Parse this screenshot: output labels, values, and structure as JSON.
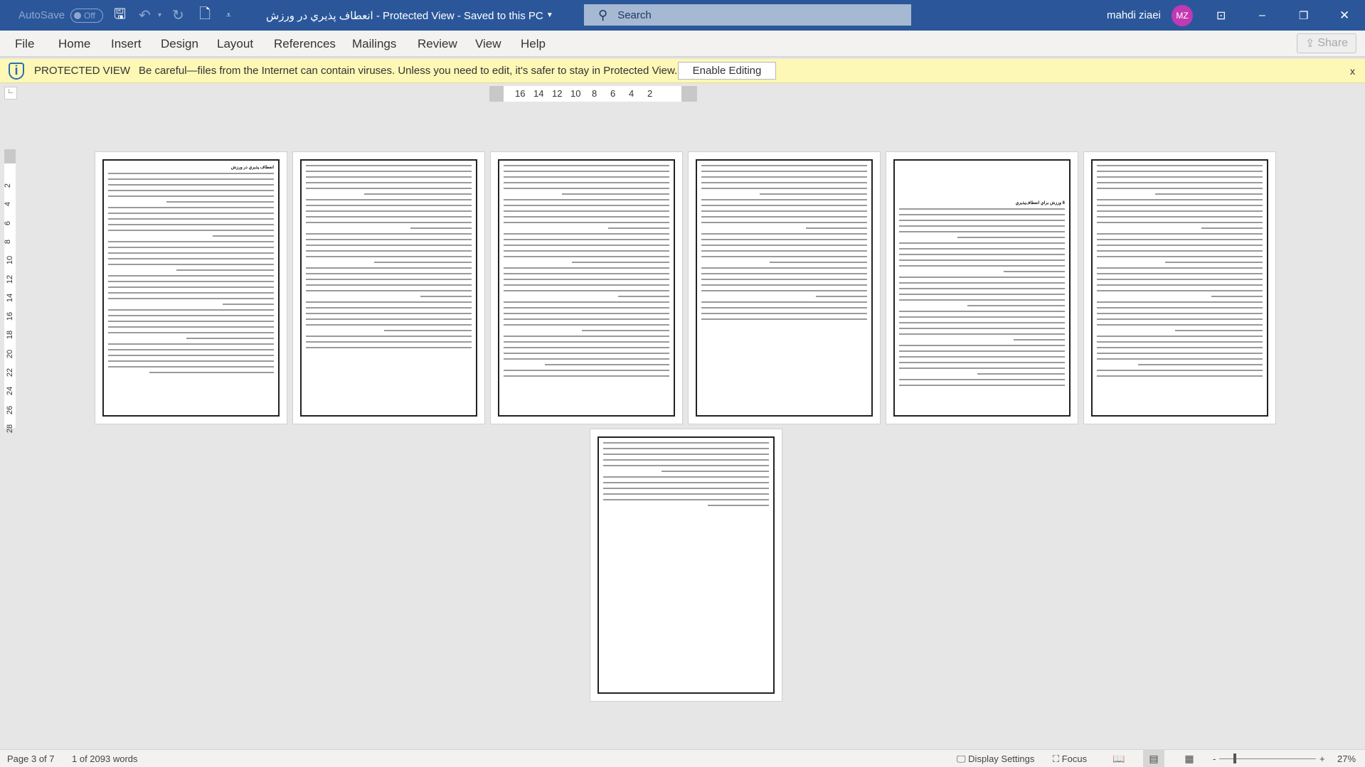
{
  "titlebar": {
    "autosave": "AutoSave",
    "autosave_state": "Off",
    "title": "انعطاف پذيري در ورزش  -  Protected View  -  Saved to this PC",
    "search_placeholder": "Search",
    "user_name": "mahdi ziaei",
    "user_initials": "MZ",
    "accent": "#2b579a",
    "avatar_color": "#c239b3"
  },
  "ribbon": {
    "tabs": [
      "File",
      "Home",
      "Insert",
      "Design",
      "Layout",
      "References",
      "Mailings",
      "Review",
      "View",
      "Help"
    ],
    "share": "Share"
  },
  "protected_bar": {
    "label": "PROTECTED VIEW",
    "message": "Be careful—files from the Internet can contain viruses. Unless you need to edit, it's safer to stay in Protected View.",
    "button": "Enable Editing",
    "close": "x"
  },
  "hruler": [
    "16",
    "14",
    "12",
    "10",
    "8",
    "6",
    "4",
    "2"
  ],
  "vruler": [
    "2",
    "4",
    "6",
    "8",
    "10",
    "12",
    "14",
    "16",
    "18",
    "20",
    "22",
    "24",
    "26",
    "28"
  ],
  "document": {
    "page1_heading": "انعطاف پذيري در ورزش",
    "page5_heading": "6 ورزش براي انعطاف‌پذيري",
    "page_count": 7
  },
  "status": {
    "page": "Page 3 of 7",
    "words": "1 of 2093 words",
    "display_settings": "Display Settings",
    "focus": "Focus",
    "zoom": "27%"
  }
}
